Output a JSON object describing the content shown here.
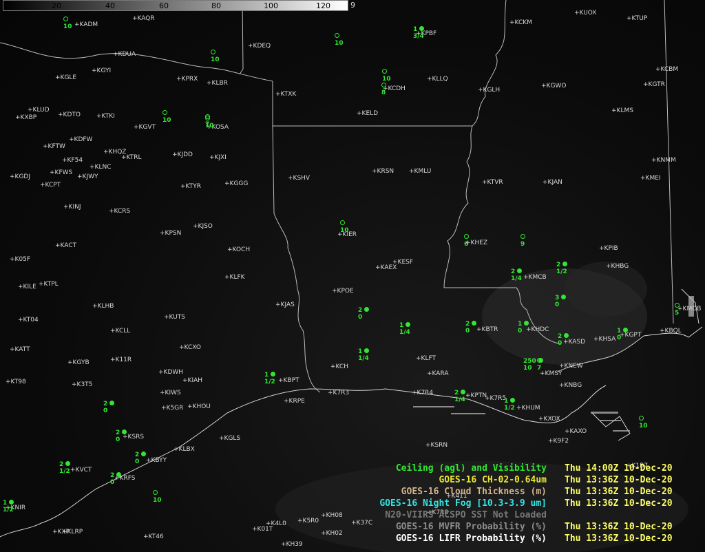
{
  "colorbar": {
    "ticks": [
      "20",
      "40",
      "60",
      "80",
      "100",
      "120"
    ],
    "end_label": "9"
  },
  "colors": {
    "obs": "#33e633",
    "legend_time": "#ffff66"
  },
  "stations": [
    {
      "id": "KADM"
    },
    {
      "id": "KAQR"
    },
    {
      "id": "KDUA"
    },
    {
      "id": "KDEQ"
    },
    {
      "id": "KGLE"
    },
    {
      "id": "KGYI"
    },
    {
      "id": "KPRX"
    },
    {
      "id": "KLBR"
    },
    {
      "id": "KTXK"
    },
    {
      "id": "KLUD"
    },
    {
      "id": "KDTO"
    },
    {
      "id": "KXBP"
    },
    {
      "id": "KTKI"
    },
    {
      "id": "KGVT"
    },
    {
      "id": "KOSA"
    },
    {
      "id": "KDFW"
    },
    {
      "id": "KFTW"
    },
    {
      "id": "KHQZ"
    },
    {
      "id": "KTRL"
    },
    {
      "id": "KJDD"
    },
    {
      "id": "KJXI"
    },
    {
      "id": "KF54"
    },
    {
      "id": "KLNC"
    },
    {
      "id": "KFWS"
    },
    {
      "id": "KJWY"
    },
    {
      "id": "KGDJ"
    },
    {
      "id": "KCPT"
    },
    {
      "id": "KTYR"
    },
    {
      "id": "KGGG"
    },
    {
      "id": "KINJ"
    },
    {
      "id": "KCRS"
    },
    {
      "id": "KPSN"
    },
    {
      "id": "KJSO"
    },
    {
      "id": "KACT"
    },
    {
      "id": "KOCH"
    },
    {
      "id": "K05F"
    },
    {
      "id": "KTPL"
    },
    {
      "id": "KILE"
    },
    {
      "id": "KLFK"
    },
    {
      "id": "KLHB"
    },
    {
      "id": "KUTS"
    },
    {
      "id": "KT04"
    },
    {
      "id": "KCLL"
    },
    {
      "id": "KJAS"
    },
    {
      "id": "KATT"
    },
    {
      "id": "KCXO"
    },
    {
      "id": "KGYB"
    },
    {
      "id": "K11R"
    },
    {
      "id": "KDWH"
    },
    {
      "id": "KIAH"
    },
    {
      "id": "KT98"
    },
    {
      "id": "K3T5"
    },
    {
      "id": "KIWS"
    },
    {
      "id": "K5GR"
    },
    {
      "id": "KHOU"
    },
    {
      "id": "KGLS"
    },
    {
      "id": "KSRS"
    },
    {
      "id": "KLBX"
    },
    {
      "id": "KBYY"
    },
    {
      "id": "KVCT"
    },
    {
      "id": "KRFS"
    },
    {
      "id": "KNIR"
    },
    {
      "id": "KT46"
    },
    {
      "id": "KLRP"
    },
    {
      "id": "KCKM"
    },
    {
      "id": "KUOX"
    },
    {
      "id": "KTUP"
    },
    {
      "id": "KPBF"
    },
    {
      "id": "KLLQ"
    },
    {
      "id": "KCDH"
    },
    {
      "id": "KGLH"
    },
    {
      "id": "KGWO"
    },
    {
      "id": "KCBM"
    },
    {
      "id": "KGTR"
    },
    {
      "id": "KELD"
    },
    {
      "id": "KLMS"
    },
    {
      "id": "KSHV"
    },
    {
      "id": "KRSN"
    },
    {
      "id": "KMLU"
    },
    {
      "id": "KTVR"
    },
    {
      "id": "KJAN"
    },
    {
      "id": "KNMM"
    },
    {
      "id": "KMEI"
    },
    {
      "id": "KIER"
    },
    {
      "id": "KHEZ"
    },
    {
      "id": "KPIB"
    },
    {
      "id": "KESF"
    },
    {
      "id": "KAEX"
    },
    {
      "id": "KHBG"
    },
    {
      "id": "KMCB"
    },
    {
      "id": "KPOE"
    },
    {
      "id": "KBTR"
    },
    {
      "id": "KHDC"
    },
    {
      "id": "KMOB"
    },
    {
      "id": "KASD"
    },
    {
      "id": "KHSA"
    },
    {
      "id": "KGPT"
    },
    {
      "id": "KBQL"
    },
    {
      "id": "KLFT"
    },
    {
      "id": "KARA"
    },
    {
      "id": "KCH"
    },
    {
      "id": "KMSY"
    },
    {
      "id": "KNEW"
    },
    {
      "id": "KNBG"
    },
    {
      "id": "KBPT"
    },
    {
      "id": "KRPE"
    },
    {
      "id": "K7R3"
    },
    {
      "id": "K7R4"
    },
    {
      "id": "KPTN"
    },
    {
      "id": "K7R5"
    },
    {
      "id": "KHUM"
    },
    {
      "id": "KXOX"
    },
    {
      "id": "KAXO"
    },
    {
      "id": "K9F2"
    },
    {
      "id": "KSRN"
    },
    {
      "id": "K411"
    },
    {
      "id": "K7R8"
    },
    {
      "id": "K1B7"
    },
    {
      "id": "K4L0"
    },
    {
      "id": "K01T"
    },
    {
      "id": "K5R0"
    },
    {
      "id": "KH08"
    },
    {
      "id": "KH02"
    },
    {
      "id": "K37C"
    },
    {
      "id": "KH39"
    },
    {
      "id": "KXP"
    }
  ],
  "observations": [
    {
      "ceil": "",
      "vis": "10"
    },
    {
      "ceil": "",
      "vis": "10"
    },
    {
      "ceil": "1",
      "vis": "3/4"
    },
    {
      "ceil": "",
      "vis": "10"
    },
    {
      "ceil": "",
      "vis": "10"
    },
    {
      "ceil": "",
      "vis": "8"
    },
    {
      "ceil": "",
      "vis": "10"
    },
    {
      "ceil": "",
      "vis": "10"
    },
    {
      "ceil": "",
      "vis": "7"
    },
    {
      "ceil": "",
      "vis": "10"
    },
    {
      "ceil": "",
      "vis": "6"
    },
    {
      "ceil": "",
      "vis": "9"
    },
    {
      "ceil": "2",
      "vis": "1/4"
    },
    {
      "ceil": "2",
      "vis": "1/2"
    },
    {
      "ceil": "3",
      "vis": "0"
    },
    {
      "ceil": "2",
      "vis": "0"
    },
    {
      "ceil": "1",
      "vis": "1/4"
    },
    {
      "ceil": "1",
      "vis": "1/4"
    },
    {
      "ceil": "2",
      "vis": "0"
    },
    {
      "ceil": "1",
      "vis": "0"
    },
    {
      "ceil": "2",
      "vis": "0"
    },
    {
      "ceil": "1",
      "vis": "0"
    },
    {
      "ceil": "250",
      "vis": "10"
    },
    {
      "ceil": "",
      "vis": "7"
    },
    {
      "ceil": "1",
      "vis": "1/2"
    },
    {
      "ceil": "2",
      "vis": "1/4"
    },
    {
      "ceil": "1",
      "vis": "1/2"
    },
    {
      "ceil": "2",
      "vis": "0"
    },
    {
      "ceil": "2",
      "vis": "0"
    },
    {
      "ceil": "2",
      "vis": "0"
    },
    {
      "ceil": "2",
      "vis": "1/2"
    },
    {
      "ceil": "2",
      "vis": "0"
    },
    {
      "ceil": "1",
      "vis": "1/2"
    },
    {
      "ceil": "",
      "vis": "10"
    },
    {
      "ceil": "",
      "vis": "10"
    },
    {
      "ceil": "",
      "vis": "5"
    }
  ],
  "legend": [
    {
      "name": "Ceiling (agl) and Visibility",
      "time": "Thu 14:00Z 10-Dec-20",
      "name_color": "#33e633",
      "time_color": "#ffff66"
    },
    {
      "name": "GOES-16 CH-02-0.64um",
      "time": "Thu 13:36Z 10-Dec-20",
      "name_color": "#e6e633",
      "time_color": "#ffff66"
    },
    {
      "name": "GOES-16 Cloud Thickness (m)",
      "time": "Thu 13:36Z 10-Dec-20",
      "name_color": "#d4b48a",
      "time_color": "#ffff66"
    },
    {
      "name": "GOES-16 Night Fog [10.3-3.9 um]",
      "time": "Thu 13:36Z 10-Dec-20",
      "name_color": "#33e6e6",
      "time_color": "#ffff66"
    },
    {
      "name": "N20-VIIRS ACSPO SST  Not Loaded",
      "time": "",
      "name_color": "#777777",
      "time_color": "#777777"
    },
    {
      "name": "GOES-16 MVFR Probability (%)",
      "time": "Thu 13:36Z 10-Dec-20",
      "name_color": "#8c8c8c",
      "time_color": "#ffff66"
    },
    {
      "name": "GOES-16 LIFR Probability (%)",
      "time": "Thu 13:36Z 10-Dec-20",
      "name_color": "#ffffff",
      "time_color": "#ffff66"
    }
  ]
}
